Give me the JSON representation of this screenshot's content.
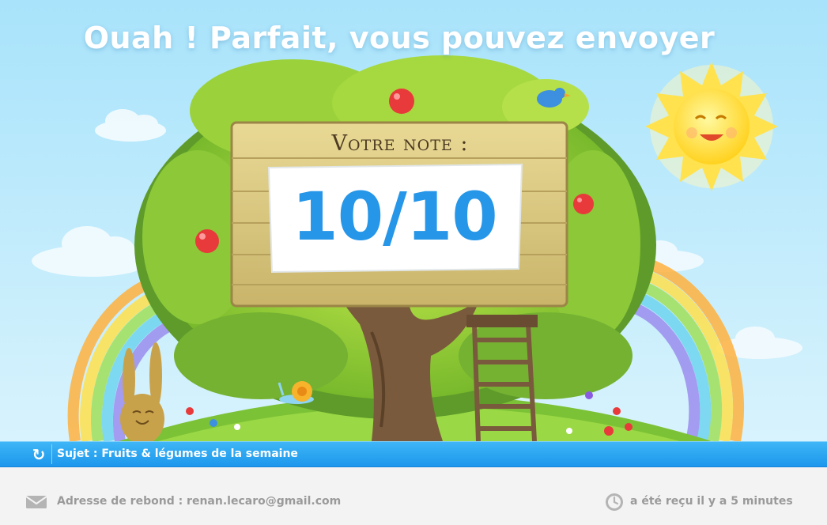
{
  "headline": "Ouah ! Parfait, vous pouvez envoyer",
  "board": {
    "title": "Votre note :",
    "score": "10/10"
  },
  "subject_bar": {
    "refresh_icon": "refresh-icon",
    "subject": "Sujet : Fruits & légumes de la semaine"
  },
  "info": {
    "bounce_icon": "envelope-icon",
    "bounce_address": "Adresse de rebond : renan.lecaro@gmail.com",
    "received_icon": "clock-icon",
    "received": "a été reçu il y a 5 minutes"
  },
  "colors": {
    "sky": "#b5e6fb",
    "bar": "#27a7f1",
    "score": "#2596e8",
    "text_gray": "#9a9a9a"
  }
}
